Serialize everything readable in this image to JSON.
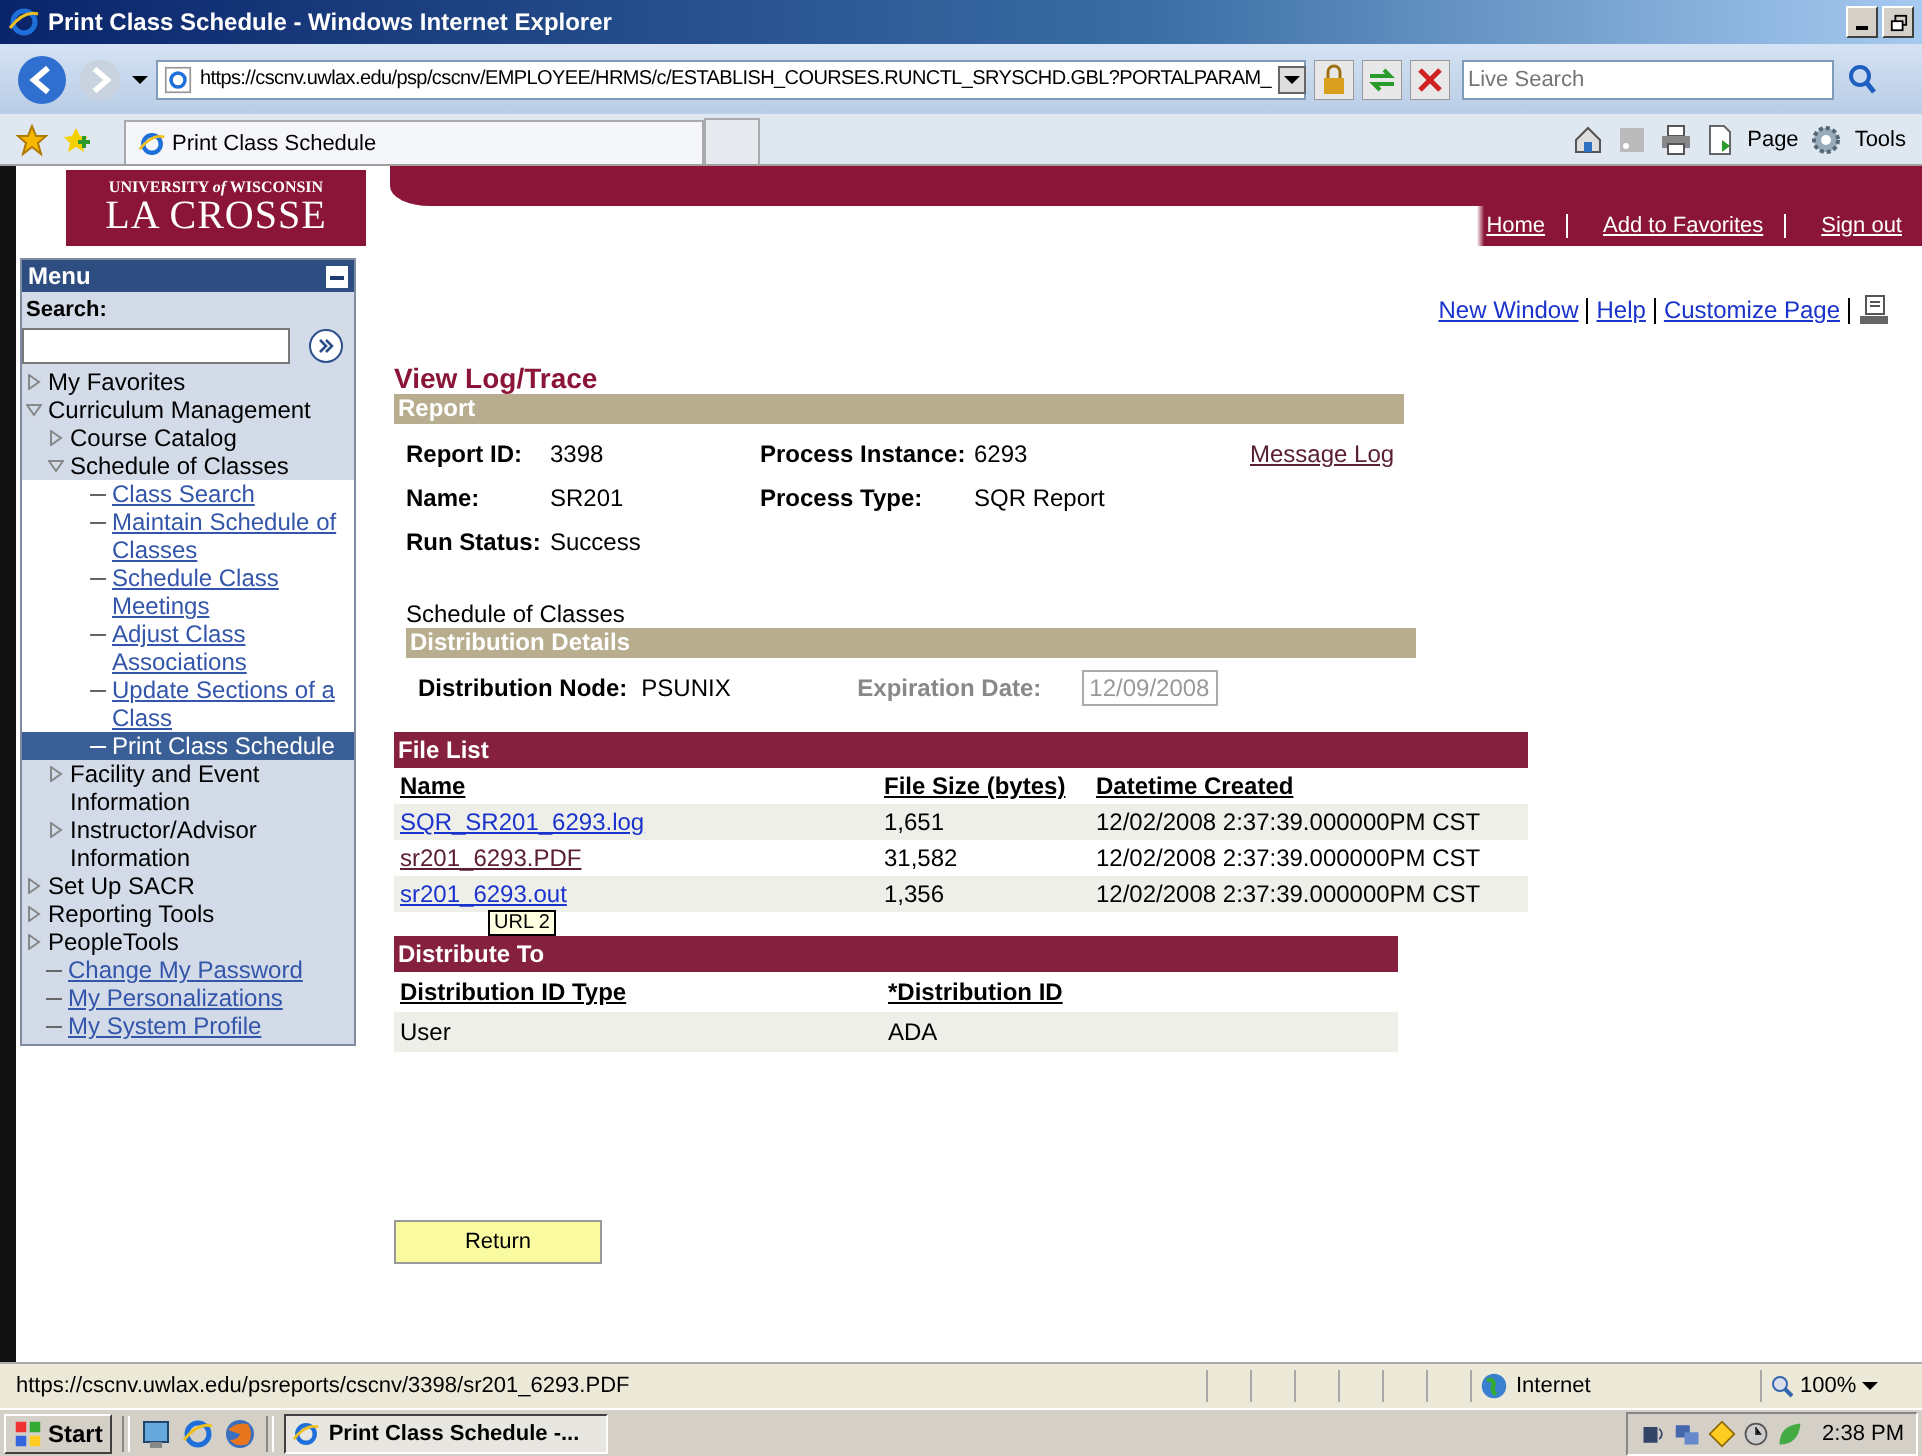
{
  "browser": {
    "title": "Print Class Schedule - Windows Internet Explorer",
    "address": "https://cscnv.uwlax.edu/psp/cscnv/EMPLOYEE/HRMS/c/ESTABLISH_COURSES.RUNCTL_SRYSCHD.GBL?PORTALPARAM_",
    "search_placeholder": "Live Search",
    "tab": "Print Class Schedule",
    "tools": [
      "Page",
      "Tools"
    ]
  },
  "header": {
    "logo_top": "UNIVERSITY *of* WISCONSIN",
    "logo_main": "LA CROSSE",
    "nav_links": [
      "Home",
      "Add to Favorites",
      "Sign out"
    ]
  },
  "menu": {
    "title": "Menu",
    "search_label": "Search:",
    "items": [
      {
        "kind": "folder",
        "label": "My Favorites",
        "expanded": false
      },
      {
        "kind": "folder",
        "label": "Curriculum Management",
        "expanded": true,
        "children": [
          {
            "kind": "folder",
            "label": "Course Catalog",
            "expanded": false
          },
          {
            "kind": "folder",
            "label": "Schedule of Classes",
            "expanded": true,
            "children": [
              {
                "kind": "link",
                "label": "Class Search",
                "selected": false
              },
              {
                "kind": "link",
                "label": "Maintain Schedule of Classes",
                "selected": false
              },
              {
                "kind": "link",
                "label": "Schedule Class Meetings",
                "selected": false
              },
              {
                "kind": "link",
                "label": "Adjust Class Associations",
                "selected": false
              },
              {
                "kind": "link",
                "label": "Update Sections of a Class",
                "selected": false
              },
              {
                "kind": "link",
                "label": "Print Class Schedule",
                "selected": true
              }
            ]
          },
          {
            "kind": "folder",
            "label": "Facility and Event Information",
            "expanded": false
          },
          {
            "kind": "folder",
            "label": "Instructor/Advisor Information",
            "expanded": false
          }
        ]
      },
      {
        "kind": "folder",
        "label": "Set Up SACR",
        "expanded": false
      },
      {
        "kind": "folder",
        "label": "Reporting Tools",
        "expanded": false
      },
      {
        "kind": "folder",
        "label": "PeopleTools",
        "expanded": false
      },
      {
        "kind": "link",
        "label": "Change My Password",
        "selected": false
      },
      {
        "kind": "link",
        "label": "My Personalizations",
        "selected": false
      },
      {
        "kind": "link",
        "label": "My System Profile",
        "selected": false
      }
    ]
  },
  "page": {
    "top_links": [
      "New Window",
      "Help",
      "Customize Page"
    ],
    "title": "View Log/Trace",
    "report": {
      "heading": "Report",
      "report_id_label": "Report ID:",
      "report_id": "3398",
      "instance_label": "Process Instance:",
      "instance": "6293",
      "message_log": "Message Log",
      "name_label": "Name:",
      "name": "SR201",
      "type_label": "Process Type:",
      "type": "SQR Report",
      "status_label": "Run Status:",
      "status": "Success",
      "description": "Schedule of Classes"
    },
    "distribution": {
      "heading": "Distribution Details",
      "node_label": "Distribution Node:",
      "node": "PSUNIX",
      "expiration_label": "Expiration Date:",
      "expiration": "12/09/2008"
    },
    "file_list": {
      "heading": "File List",
      "columns": [
        "Name",
        "File Size (bytes)",
        "Datetime Created"
      ],
      "rows": [
        {
          "name": "SQR_SR201_6293.log",
          "size": "1,651",
          "created": "12/02/2008  2:37:39.000000PM CST",
          "visited": false
        },
        {
          "name": "sr201_6293.PDF",
          "size": "31,582",
          "created": "12/02/2008  2:37:39.000000PM CST",
          "visited": true
        },
        {
          "name": "sr201_6293.out",
          "size": "1,356",
          "created": "12/02/2008  2:37:39.000000PM CST",
          "visited": false
        }
      ]
    },
    "tooltip": "URL 2",
    "distribute_to": {
      "heading": "Distribute To",
      "columns": [
        "Distribution ID Type",
        "*Distribution ID"
      ],
      "rows": [
        [
          "User",
          "ADA"
        ]
      ]
    },
    "return_button": "Return"
  },
  "status_bar": {
    "url": "https://cscnv.uwlax.edu/psreports/cscnv/3398/sr201_6293.PDF",
    "zone": "Internet",
    "zoom": "100%"
  },
  "taskbar": {
    "start": "Start",
    "task": "Print Class Schedule -...",
    "clock": "2:38 PM"
  }
}
